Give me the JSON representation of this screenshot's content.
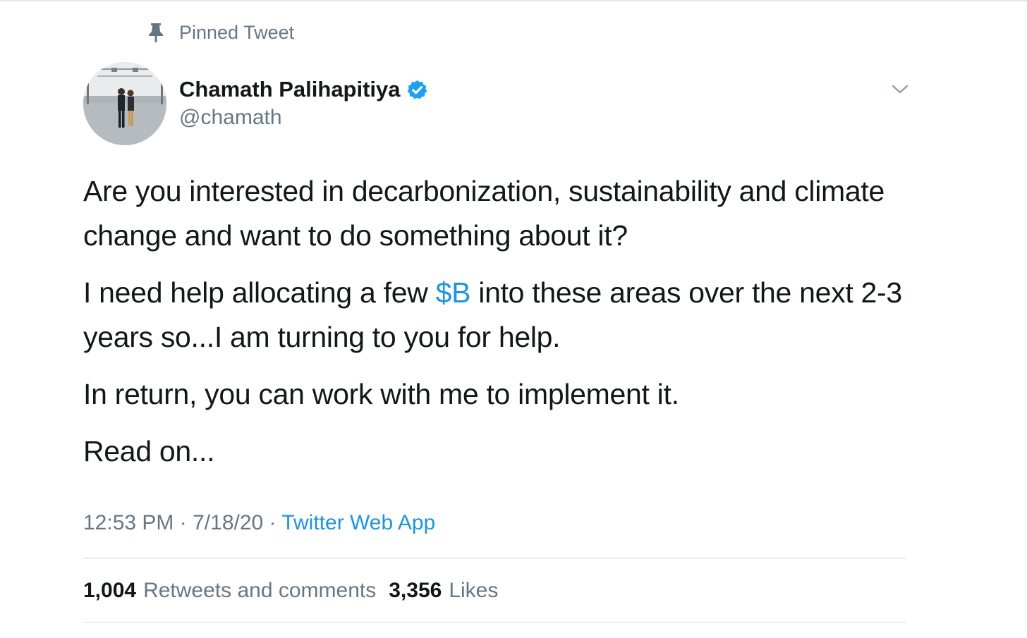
{
  "pinned_label": "Pinned Tweet",
  "author": {
    "name": "Chamath Palihapitiya",
    "handle": "@chamath",
    "verified": true
  },
  "tweet": {
    "p1": "Are you interested in decarbonization, sustainability and climate change and want to do something about it?",
    "p2_before": "I need help allocating a few ",
    "p2_link": "$B",
    "p2_after": " into these areas over the next 2-3 years so...I am turning to you for help.",
    "p3": "In return, you can work with me to implement it.",
    "p4": "Read on..."
  },
  "meta": {
    "time": "12:53 PM",
    "separator": "·",
    "date": "7/18/20",
    "source": "Twitter Web App"
  },
  "stats": {
    "retweets_count": "1,004",
    "retweets_label": "Retweets and comments",
    "likes_count": "3,356",
    "likes_label": "Likes"
  },
  "colors": {
    "link": "#1b95e0",
    "secondary_text": "#657786",
    "primary_text": "#14171a",
    "verified": "#1da1f2"
  },
  "icons": {
    "pin": "pin-icon",
    "verified": "verified-badge-icon",
    "caret": "chevron-down-icon"
  }
}
